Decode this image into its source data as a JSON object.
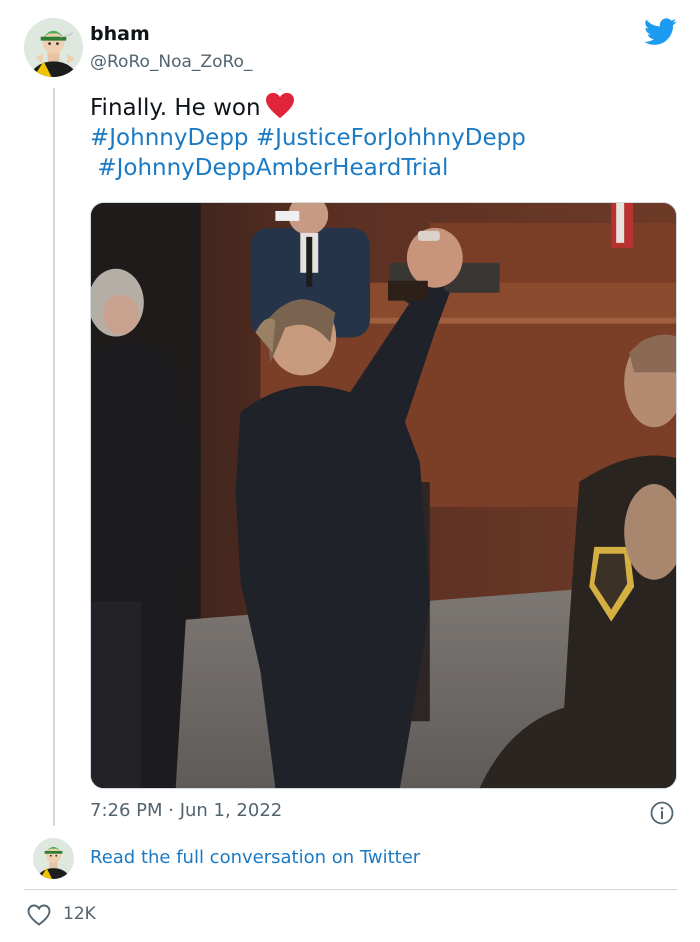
{
  "author": {
    "name": "bham",
    "handle": "@RoRo_Noa_ZoRo_"
  },
  "tweet": {
    "line1": "Finally. He won",
    "tags_line2": [
      "#JohnnyDepp",
      "#JusticeForJohhnyDepp"
    ],
    "tags_line3": [
      "#JohnnyDeppAmberHeardTrial"
    ],
    "emoji": "heart"
  },
  "media": {
    "image_description": ""
  },
  "meta": {
    "timestamp": "7:26 PM · Jun 1, 2022"
  },
  "footer": {
    "read_link": "Read the full conversation on Twitter",
    "like_count": "12K"
  },
  "icons": {
    "brand": "twitter-bird-icon",
    "info": "info-icon",
    "like": "heart-outline-icon"
  },
  "colors": {
    "link": "#1b7ac4",
    "twitter_blue": "#1d9bf0",
    "secondary_text": "#536471",
    "heart_red": "#e0243a"
  }
}
